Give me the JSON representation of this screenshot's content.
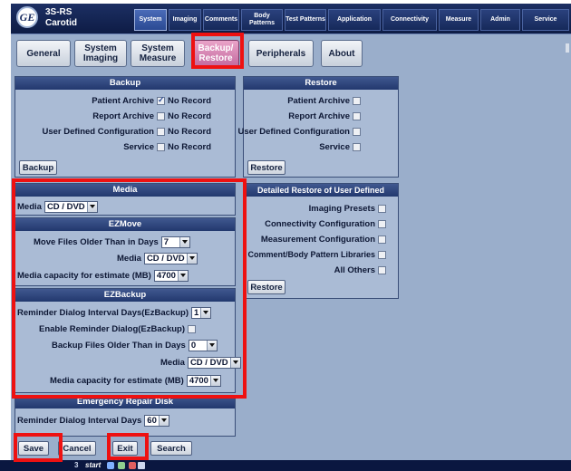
{
  "header": {
    "logo_text": "GE",
    "model": "3S-RS",
    "probe": "Carotid",
    "tabs": [
      {
        "label": "System"
      },
      {
        "label": "Imaging"
      },
      {
        "label": "Comments"
      },
      {
        "label": "Body Patterns"
      },
      {
        "label": "Test Patterns"
      },
      {
        "label": "Application"
      },
      {
        "label": "Connectivity"
      },
      {
        "label": "Measure"
      },
      {
        "label": "Admin"
      },
      {
        "label": "Service"
      }
    ]
  },
  "subtabs": [
    {
      "label": "General"
    },
    {
      "label": "System Imaging"
    },
    {
      "label": "System Measure"
    },
    {
      "label": "Backup/ Restore"
    },
    {
      "label": "Peripherals"
    },
    {
      "label": "About"
    }
  ],
  "backup": {
    "title": "Backup",
    "rows": [
      {
        "label": "Patient Archive",
        "checked": true,
        "status": "No Record"
      },
      {
        "label": "Report Archive",
        "checked": false,
        "status": "No Record"
      },
      {
        "label": "User Defined Configuration",
        "checked": false,
        "status": "No Record"
      },
      {
        "label": "Service",
        "checked": false,
        "status": "No Record"
      }
    ],
    "button": "Backup"
  },
  "restore": {
    "title": "Restore",
    "rows": [
      "Patient Archive",
      "Report Archive",
      "User Defined Configuration",
      "Service"
    ],
    "button": "Restore"
  },
  "detailed_restore": {
    "title": "Detailed Restore of User Defined",
    "rows": [
      "Imaging Presets",
      "Connectivity Configuration",
      "Measurement Configuration",
      "Comment/Body Pattern Libraries",
      "All Others"
    ],
    "button": "Restore"
  },
  "media": {
    "title": "Media",
    "label": "Media",
    "value": "CD / DVD"
  },
  "ezmove": {
    "title": "EZMove",
    "older_label": "Move Files Older Than in Days",
    "older_value": "7",
    "media_label": "Media",
    "media_value": "CD / DVD",
    "capacity_label": "Media capacity for estimate (MB)",
    "capacity_value": "4700"
  },
  "ezbackup": {
    "title": "EZBackup",
    "interval_label": "Reminder Dialog Interval Days(EzBackup)",
    "interval_value": "1",
    "enable_label": "Enable Reminder Dialog(EzBackup)",
    "older_label": "Backup Files Older Than in Days",
    "older_value": "0",
    "media_label": "Media",
    "media_value": "CD / DVD",
    "capacity_label": "Media capacity for estimate (MB)",
    "capacity_value": "4700"
  },
  "erd": {
    "title": "Emergency Repair Disk",
    "interval_label": "Reminder Dialog Interval Days",
    "interval_value": "60"
  },
  "footer": {
    "save": "Save",
    "cancel": "Cancel",
    "exit": "Exit",
    "search": "Search"
  },
  "taskbar": {
    "count": "3",
    "start": "start"
  },
  "colors": {
    "highlight": "#ee1111",
    "active_subtab": "#c46aa0",
    "header_bg": "#1c2f63"
  }
}
